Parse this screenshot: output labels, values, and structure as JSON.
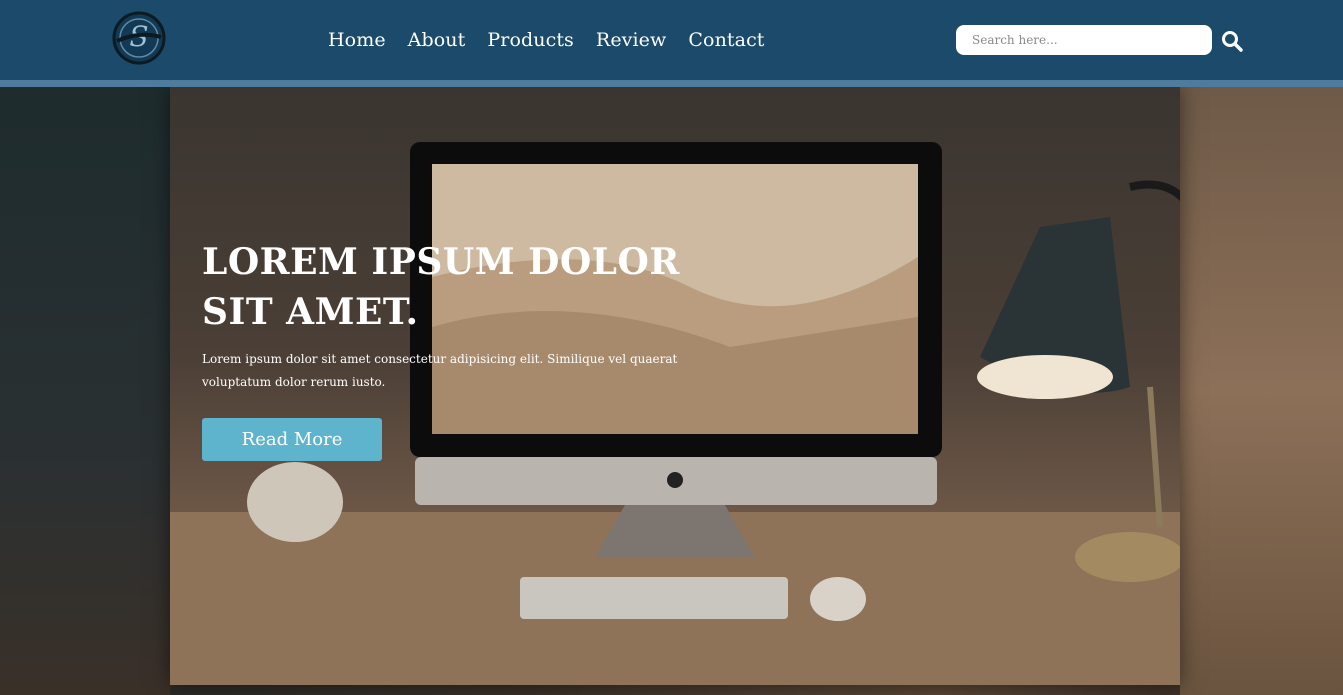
{
  "header": {
    "logo_icon": "brand-logo-icon",
    "nav": [
      {
        "label": "Home"
      },
      {
        "label": "About"
      },
      {
        "label": "Products"
      },
      {
        "label": "Review"
      },
      {
        "label": "Contact"
      }
    ],
    "search": {
      "placeholder": "Search here...",
      "value": "",
      "icon": "search-icon"
    },
    "colors": {
      "bar": "#1b4a6a",
      "stripe": "#4f7c9c"
    }
  },
  "hero": {
    "title": "LOREM IPSUM DOLOR SIT AMET.",
    "text": "Lorem ipsum dolor sit amet consectetur adipisicing elit. Similique vel quaerat voluptatum dolor rerum iusto.",
    "button_label": "Read More",
    "button_color": "#5fb4cd"
  }
}
